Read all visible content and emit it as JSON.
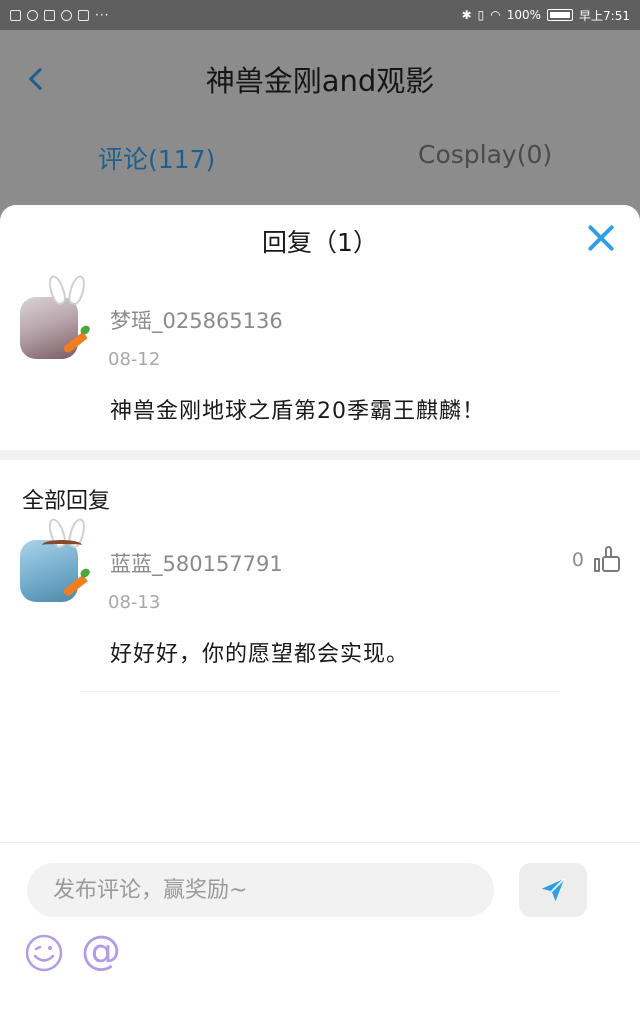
{
  "status_bar": {
    "battery": "100%",
    "time": "早上7:51",
    "dots": "···"
  },
  "header": {
    "title": "神兽金刚and观影",
    "tabs": [
      {
        "label": "评论(117)",
        "active": true
      },
      {
        "label": "Cosplay(0)",
        "active": false
      }
    ]
  },
  "sheet": {
    "title": "回复（1）",
    "original_comment": {
      "username": "梦瑶_025865136",
      "date": "08-12",
      "text": "神兽金刚地球之盾第20季霸王麒麟！"
    },
    "section_label": "全部回复",
    "replies": [
      {
        "username": "蓝蓝_580157791",
        "date": "08-13",
        "text": "好好好，你的愿望都会实现。",
        "likes": "0"
      }
    ]
  },
  "input": {
    "placeholder": "发布评论，赢奖励~",
    "at_symbol": "@"
  },
  "colors": {
    "accent": "#2e9fe6",
    "tab_active": "#1f5f8e",
    "icon_purple": "#b39be8"
  }
}
